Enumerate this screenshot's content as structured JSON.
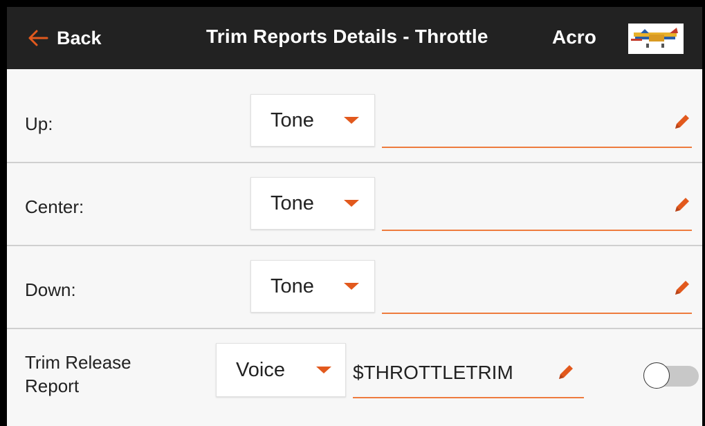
{
  "header": {
    "back_label": "Back",
    "title": "Trim Reports Details - Throttle",
    "model_name": "Acro"
  },
  "rows": [
    {
      "label": "Up:",
      "type_value": "Tone",
      "field_value": ""
    },
    {
      "label": "Center:",
      "type_value": "Tone",
      "field_value": ""
    },
    {
      "label": "Down:",
      "type_value": "Tone",
      "field_value": ""
    }
  ],
  "trim_release": {
    "label_line1": "Trim Release",
    "label_line2": "Report",
    "type_value": "Voice",
    "field_value": "$THROTTLETRIM",
    "enabled": false
  },
  "colors": {
    "accent": "#e2591d",
    "header_bg": "#222222",
    "underline": "#ee7b3d"
  }
}
